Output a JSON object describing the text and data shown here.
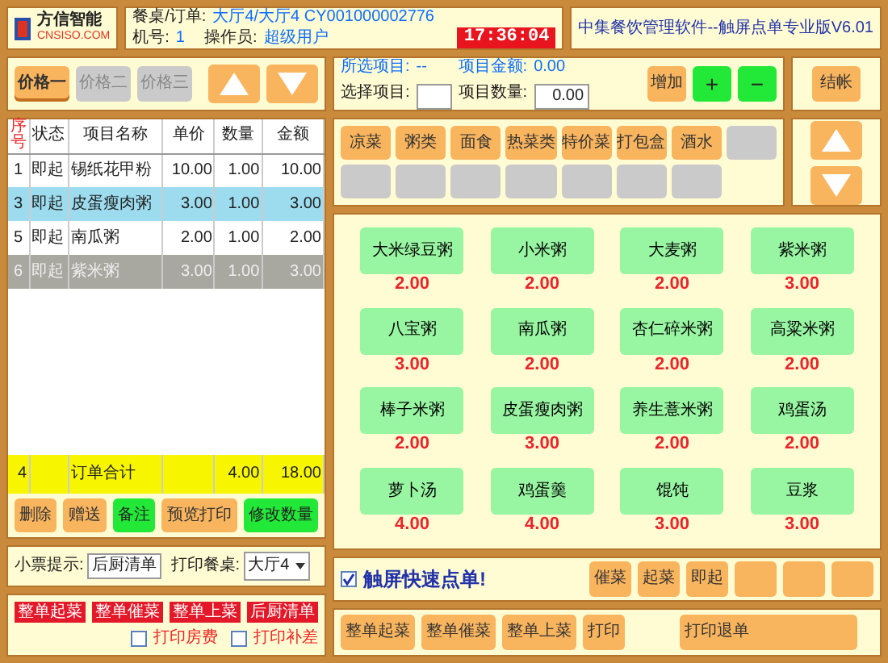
{
  "header": {
    "logo_text": "方信智能",
    "logo_sub": "CNSISO.COM",
    "order_label": "餐桌/订单:",
    "order_value": "大厅4/大厅4 CY001000002776",
    "machine_label": "机号:",
    "machine_value": "1",
    "operator_label": "操作员:",
    "operator_value": "超级用户",
    "clock": "17:36:04",
    "app_title": "中集餐饮管理软件--触屏点单专业版V6.01"
  },
  "price_tabs": [
    {
      "label": "价格一",
      "selected": true,
      "disabled": false
    },
    {
      "label": "价格二",
      "selected": false,
      "disabled": true
    },
    {
      "label": "价格三",
      "selected": false,
      "disabled": true
    }
  ],
  "info": {
    "selected_label": "所选项目:",
    "selected_value": "--",
    "amount_label": "项目金额:",
    "amount_value": "0.00",
    "choose_label": "选择项目:",
    "qty_label": "项目数量:",
    "qty_value": "0.00"
  },
  "qty_buttons": [
    {
      "label": "增加",
      "kind": "text"
    },
    {
      "label": "+",
      "kind": "green"
    },
    {
      "label": "−",
      "kind": "green"
    }
  ],
  "checkout_button": "结帐",
  "categories": [
    {
      "label": "凉菜"
    },
    {
      "label": "粥类"
    },
    {
      "label": "面食"
    },
    {
      "label": "热菜类"
    },
    {
      "label": "特价菜"
    },
    {
      "label": "打包盒"
    },
    {
      "label": "酒水"
    },
    {
      "kind": "blank"
    },
    {
      "kind": "blank"
    },
    {
      "kind": "blank"
    },
    {
      "kind": "blank"
    },
    {
      "kind": "blank"
    },
    {
      "kind": "blank"
    },
    {
      "kind": "blank"
    },
    {
      "kind": "blank"
    }
  ],
  "order_table": {
    "columns": [
      "序号",
      "状态",
      "项目名称",
      "单价",
      "数量",
      "金额"
    ],
    "rows": [
      {
        "cells": [
          "1",
          "即起",
          "锡纸花甲粉",
          "10.00",
          "1.00",
          "10.00"
        ],
        "selected": false,
        "dimmed": false
      },
      {
        "cells": [
          "3",
          "即起",
          "皮蛋瘦肉粥",
          "3.00",
          "1.00",
          "3.00"
        ],
        "selected": true,
        "dimmed": false
      },
      {
        "cells": [
          "5",
          "即起",
          "南瓜粥",
          "2.00",
          "1.00",
          "2.00"
        ],
        "selected": false,
        "dimmed": false
      },
      {
        "cells": [
          "6",
          "即起",
          "紫米粥",
          "3.00",
          "1.00",
          "3.00"
        ],
        "selected": false,
        "dimmed": true
      }
    ],
    "total": {
      "count": "4",
      "label": "订单合计",
      "qty": "4.00",
      "amount": "18.00"
    }
  },
  "order_actions": [
    {
      "label": "删除",
      "kind": "orange"
    },
    {
      "label": "赠送",
      "kind": "orange"
    },
    {
      "label": "备注",
      "kind": "green"
    },
    {
      "label": "预览打印",
      "kind": "orange"
    },
    {
      "label": "修改数量",
      "kind": "green"
    }
  ],
  "ticket": {
    "hint_label": "小票提示:",
    "hint_value": "后厨清单",
    "table_label": "打印餐桌:",
    "table_value": "大厅4"
  },
  "red_tags": [
    "整单起菜",
    "整单催菜",
    "整单上菜",
    "后厨清单"
  ],
  "print_options": [
    {
      "label": "打印房费",
      "checked": false
    },
    {
      "label": "打印补差",
      "checked": false
    }
  ],
  "menu_items": [
    {
      "name": "大米绿豆粥",
      "price": "2.00"
    },
    {
      "name": "小米粥",
      "price": "2.00"
    },
    {
      "name": "大麦粥",
      "price": "2.00"
    },
    {
      "name": "紫米粥",
      "price": "3.00"
    },
    {
      "name": "八宝粥",
      "price": "3.00"
    },
    {
      "name": "南瓜粥",
      "price": "2.00"
    },
    {
      "name": "杏仁碎米粥",
      "price": "2.00"
    },
    {
      "name": "高粱米粥",
      "price": "2.00"
    },
    {
      "name": "棒子米粥",
      "price": "2.00"
    },
    {
      "name": "皮蛋瘦肉粥",
      "price": "3.00"
    },
    {
      "name": "养生薏米粥",
      "price": "2.00"
    },
    {
      "name": "鸡蛋汤",
      "price": "2.00"
    },
    {
      "name": "萝卜汤",
      "price": "4.00"
    },
    {
      "name": "鸡蛋羹",
      "price": "4.00"
    },
    {
      "name": "馄饨",
      "price": "3.00"
    },
    {
      "name": "豆浆",
      "price": "3.00"
    }
  ],
  "quick_order": {
    "label": "触屏快速点单!",
    "checked": true
  },
  "kitchen_buttons": [
    {
      "label": "催菜"
    },
    {
      "label": "起菜"
    },
    {
      "label": "即起"
    },
    {
      "kind": "blank"
    },
    {
      "kind": "blank"
    },
    {
      "kind": "blank"
    }
  ],
  "bottom_buttons": [
    {
      "label": "整单起菜"
    },
    {
      "label": "整单催菜"
    },
    {
      "label": "整单上菜"
    },
    {
      "label": "打印"
    },
    {
      "label": "打印退单"
    }
  ]
}
